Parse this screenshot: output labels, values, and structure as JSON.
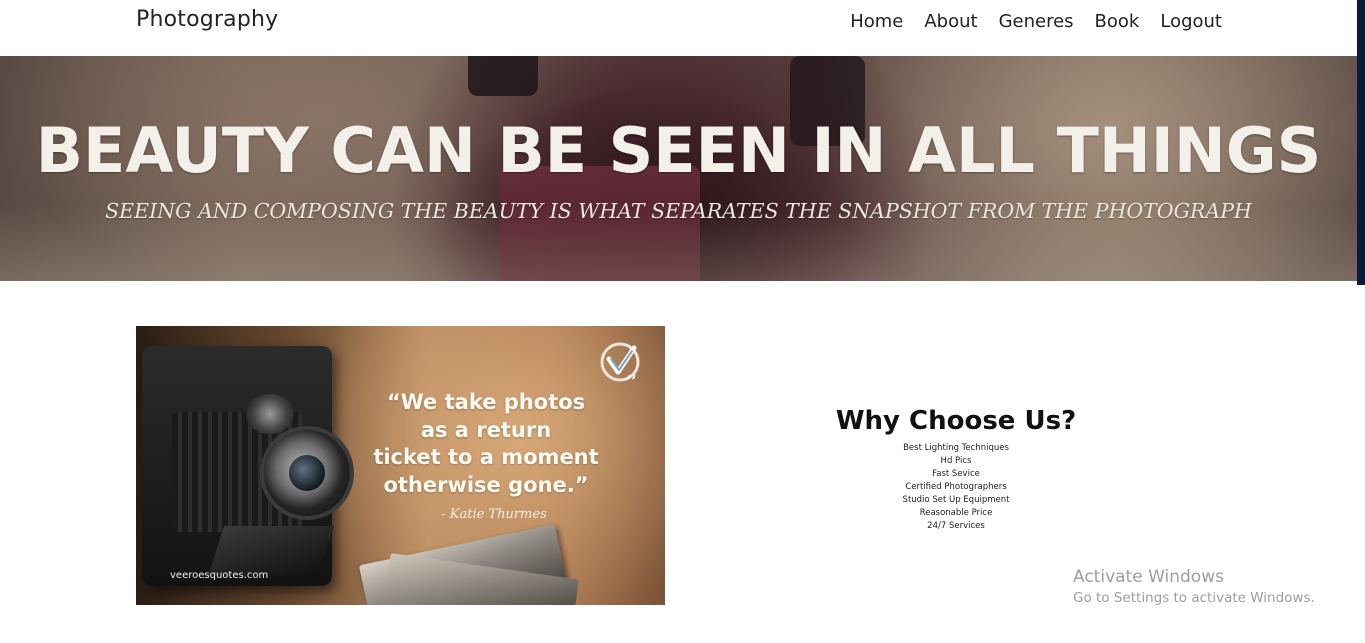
{
  "navbar": {
    "brand": "Photography",
    "links": [
      "Home",
      "About",
      "Generes",
      "Book",
      "Logout"
    ]
  },
  "hero": {
    "title": "BEAUTY CAN BE SEEN IN ALL THINGS",
    "subtitle": "SEEING AND COMPOSING THE BEAUTY IS WHAT SEPARATES THE SNAPSHOT FROM THE PHOTOGRAPH"
  },
  "quote_image": {
    "quote": "“We take photos\nas a return\nticket to a moment\notherwise gone.”",
    "author": "- Katie Thurmes",
    "site": "veeroesquotes.com",
    "logo_icon": "checkmark-logo-icon"
  },
  "why_choose_us": {
    "title": "Why Choose Us?",
    "items": [
      "Best Lighting Techniques",
      "Hd Pics",
      "Fast Sevice",
      "Certified Photographers",
      "Studio Set Up Equipment",
      "Reasonable Price",
      "24/7 Services"
    ]
  },
  "watermark": {
    "title": "Activate Windows",
    "subtitle": "Go to Settings to activate Windows."
  },
  "colors": {
    "scrollbar_strip": "#0d1a3b",
    "nav_text": "#222222",
    "heading_text": "#111111",
    "watermark_text": "#969696"
  }
}
